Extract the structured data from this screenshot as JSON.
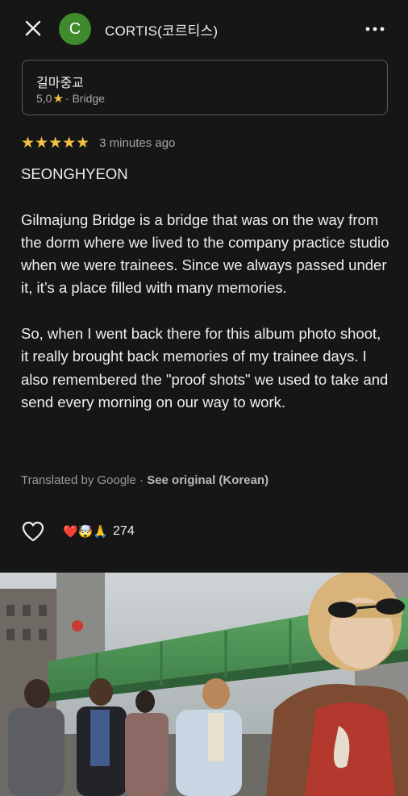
{
  "header": {
    "avatar_initial": "C",
    "author_name": "CORTIS(코르티스)"
  },
  "place": {
    "name": "길마중교",
    "rating": "5,0",
    "category": "· Bridge"
  },
  "review": {
    "stars": "★★★★★",
    "rating_value": 5,
    "time_ago": "3 minutes ago",
    "author_line": "SEONGHYEON",
    "paragraph1": "Gilmajung Bridge is a bridge that was on the way from the dorm where we lived to the company practice studio when we were trainees. Since we always passed under it, it’s a place filled with many memories.",
    "paragraph2": "So, when I went back there for this album photo shoot, it really brought back memories of my trainee days. I also remembered the \"proof shots\" we used to take and send every morning on our way to work."
  },
  "translation": {
    "label": "Translated by Google ·",
    "link": "See original (Korean)"
  },
  "reactions": {
    "emojis": "❤️🤯🙏",
    "count": "274"
  },
  "colors": {
    "background": "#161616",
    "avatar": "#3f8a2c",
    "star": "#f2c142",
    "bridge": "#4e9a57"
  },
  "icons": [
    "close-icon",
    "more-icon",
    "star-icon",
    "heart-icon"
  ]
}
